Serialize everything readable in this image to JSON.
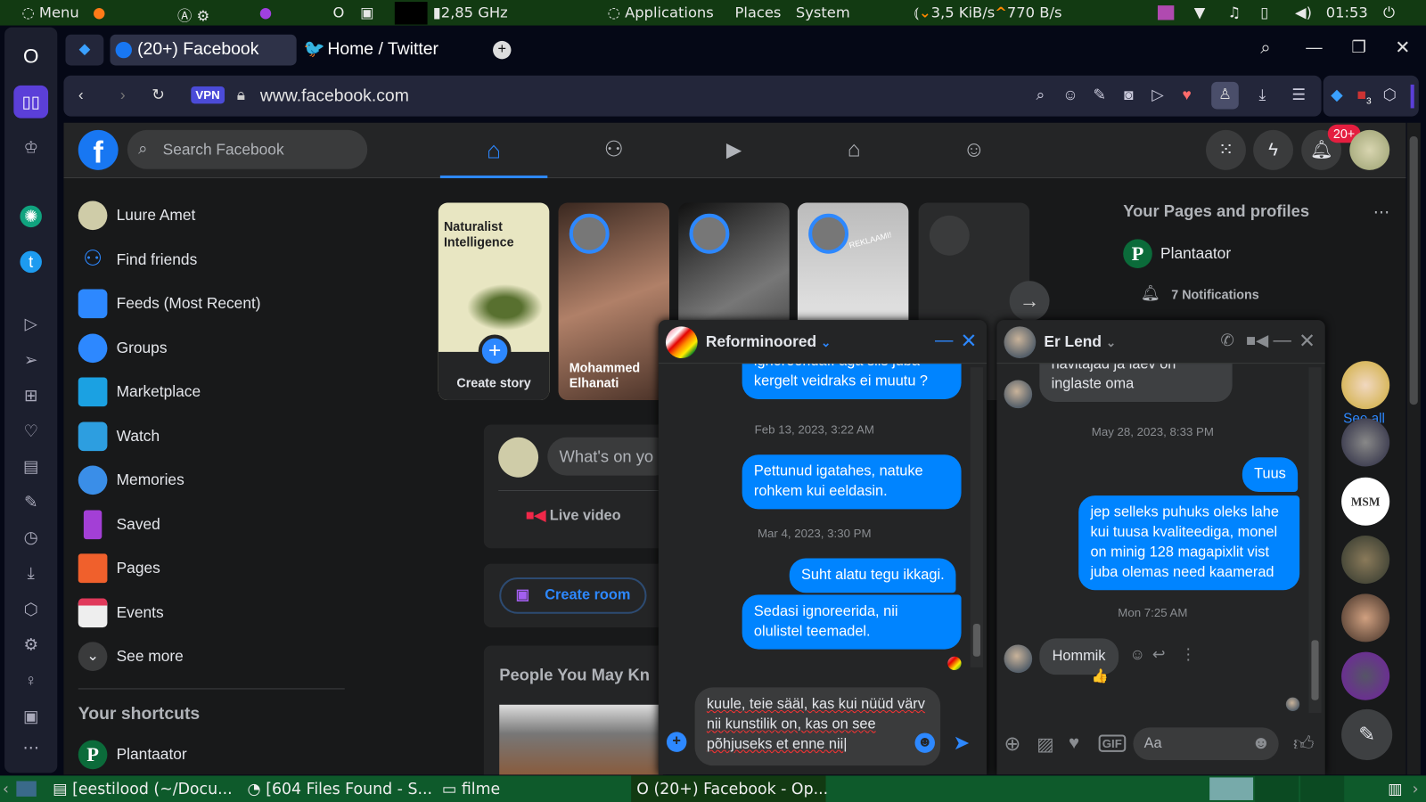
{
  "os_bar": {
    "menu": "Menu",
    "cpu": "2,85 GHz",
    "applications": "Applications",
    "places": "Places",
    "system": "System",
    "net_down": "3,5 KiB/s",
    "net_up": "770 B/s",
    "clock": "01:53"
  },
  "browser": {
    "tabs": [
      {
        "label": "(20+) Facebook",
        "active": true
      },
      {
        "label": "Home / Twitter",
        "active": false
      }
    ],
    "vpn": "VPN",
    "url": "www.facebook.com",
    "ext_badge": "3"
  },
  "facebook": {
    "search_placeholder": "Search Facebook",
    "notif_badge": "20+",
    "sidebar": [
      {
        "label": "Luure Amet",
        "icon": "avatar"
      },
      {
        "label": "Find friends",
        "icon": "friends-icon"
      },
      {
        "label": "Feeds (Most Recent)",
        "icon": "feeds-icon"
      },
      {
        "label": "Groups",
        "icon": "groups-icon"
      },
      {
        "label": "Marketplace",
        "icon": "marketplace-icon"
      },
      {
        "label": "Watch",
        "icon": "watch-icon"
      },
      {
        "label": "Memories",
        "icon": "memories-icon"
      },
      {
        "label": "Saved",
        "icon": "saved-icon"
      },
      {
        "label": "Pages",
        "icon": "pages-icon"
      },
      {
        "label": "Events",
        "icon": "events-icon"
      },
      {
        "label": "See more",
        "icon": "chevron-down-icon"
      }
    ],
    "shortcuts_title": "Your shortcuts",
    "shortcuts": [
      {
        "label": "Plantaator"
      }
    ],
    "stories": {
      "create_label": "Create story",
      "create_card_text": "Naturalist Intelligence",
      "story2_name": "Mohammed Elhanati",
      "story4_text": "REKLAAMI!"
    },
    "composer": {
      "placeholder": "What's on yo",
      "live_video": "Live video",
      "create_room": "Create room",
      "people_title": "People You May Kn"
    },
    "right": {
      "pages_title": "Your Pages and profiles",
      "page_name": "Plantaator",
      "notifications": "7 Notifications",
      "see_all": "See all"
    },
    "colors": {
      "accent": "#0084ff",
      "fb_blue": "#2d88ff",
      "badge": "#e41e3f"
    }
  },
  "chat1": {
    "name": "Reforminoored",
    "messages": [
      {
        "type": "out",
        "text": "ignoreerida.. aga siis juba kergelt veidraks ei muutu ?"
      },
      {
        "type": "time",
        "text": "Feb 13, 2023, 3:22 AM"
      },
      {
        "type": "out",
        "text": "Pettunud igatahes, natuke rohkem kui eeldasin."
      },
      {
        "type": "time",
        "text": "Mar 4, 2023, 3:30 PM"
      },
      {
        "type": "out",
        "text": "Suht alatu tegu ikkagi."
      },
      {
        "type": "out",
        "text": "Sedasi ignoreerida, nii olulistel teemadel."
      }
    ],
    "input_value": "kuule, teie sääl, kas kui nüüd värv nii kunstilik on, kas on see põhjuseks et enne nii"
  },
  "chat2": {
    "name": "Er Lend",
    "messages": [
      {
        "type": "in",
        "text": "havitajad ja laev on inglaste oma"
      },
      {
        "type": "time",
        "text": "May 28, 2023, 8:33 PM"
      },
      {
        "type": "out",
        "text": "Tuus"
      },
      {
        "type": "out",
        "text": "jep selleks puhuks oleks lahe kui tuusa kvaliteediga, monel on minig 128 magapixlit vist juba olemas need kaamerad"
      },
      {
        "type": "time",
        "text": "Mon 7:25 AM"
      },
      {
        "type": "in",
        "text": "Hommik",
        "reaction": "👍"
      }
    ],
    "input_placeholder": "Aa"
  },
  "taskbar": {
    "items": [
      "[eestilood (~/Docu...",
      "[604 Files Found - S...",
      "filme",
      "(20+) Facebook - Op..."
    ]
  }
}
